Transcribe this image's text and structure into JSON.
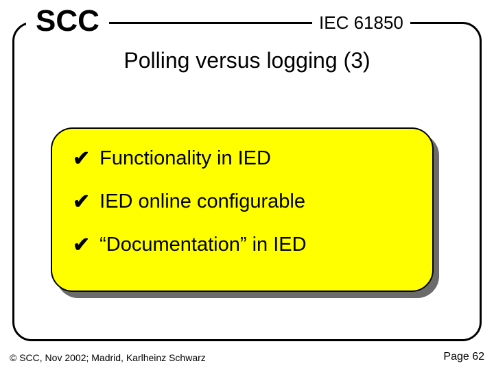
{
  "header": {
    "logo": "SCC",
    "spec": "IEC 61850",
    "title": "Polling versus logging (3)"
  },
  "bullets": [
    "Functionality in IED",
    "IED online configurable",
    "“Documentation” in IED"
  ],
  "footer": {
    "copyright": "© SCC, Nov 2002; Madrid, Karlheinz Schwarz",
    "page": "Page 62"
  }
}
